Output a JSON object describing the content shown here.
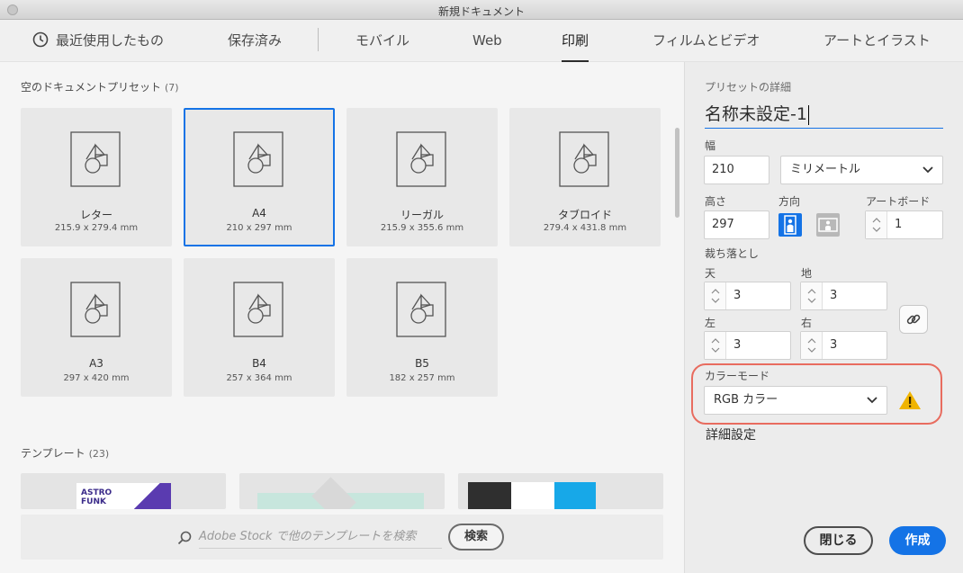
{
  "window": {
    "title": "新規ドキュメント"
  },
  "tabs": [
    {
      "label": "最近使用したもの"
    },
    {
      "label": "保存済み"
    },
    {
      "label": "モバイル"
    },
    {
      "label": "Web"
    },
    {
      "label": "印刷"
    },
    {
      "label": "フィルムとビデオ"
    },
    {
      "label": "アートとイラスト"
    }
  ],
  "active_tab": "印刷",
  "presets": {
    "heading": "空のドキュメントプリセット",
    "count": "(7)",
    "items": [
      {
        "name": "レター",
        "size": "215.9 x 279.4 mm"
      },
      {
        "name": "A4",
        "size": "210 x 297 mm"
      },
      {
        "name": "リーガル",
        "size": "215.9 x 355.6 mm"
      },
      {
        "name": "タブロイド",
        "size": "279.4 x 431.8 mm"
      },
      {
        "name": "A3",
        "size": "297 x 420 mm"
      },
      {
        "name": "B4",
        "size": "257 x 364 mm"
      },
      {
        "name": "B5",
        "size": "182 x 257 mm"
      }
    ],
    "selected": "A4"
  },
  "templates": {
    "heading": "テンプレート",
    "count": "(23)",
    "thumb1_text": "ASTRO FUNK"
  },
  "search": {
    "placeholder": "Adobe Stock で他のテンプレートを検索",
    "button": "検索"
  },
  "details": {
    "heading": "プリセットの詳細",
    "name": "名称未設定-1",
    "width_label": "幅",
    "width": "210",
    "unit": "ミリメートル",
    "height_label": "高さ",
    "height": "297",
    "orientation_label": "方向",
    "artboard_label": "アートボード",
    "artboard": "1",
    "bleed_label": "裁ち落とし",
    "bleed_top_label": "天",
    "bleed_top": "3",
    "bleed_bottom_label": "地",
    "bleed_bottom": "3",
    "bleed_left_label": "左",
    "bleed_left": "3",
    "bleed_right_label": "右",
    "bleed_right": "3",
    "color_mode_label": "カラーモード",
    "color_mode": "RGB カラー",
    "advanced": "詳細設定"
  },
  "buttons": {
    "close": "閉じる",
    "create": "作成"
  },
  "colors": {
    "accent": "#1473e6",
    "highlight": "#e86c5f",
    "warning": "#f0b400"
  }
}
